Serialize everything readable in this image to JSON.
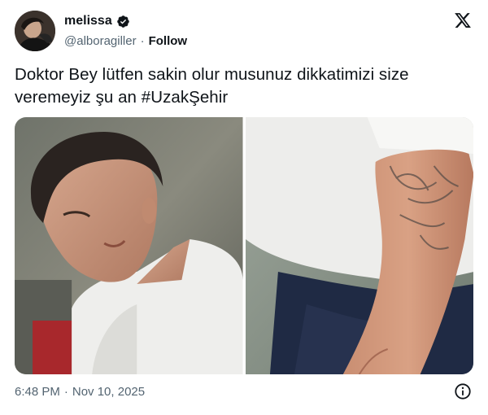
{
  "author": {
    "display_name": "melissa",
    "handle": "@alboragiller",
    "separator": "·",
    "follow_label": "Follow",
    "verified": true,
    "verified_color": "#0f1419"
  },
  "tweet": {
    "text_before_hashtag": "Doktor Bey lütfen sakin olur musunuz dikkatimizi size veremeyiz şu an ",
    "hashtag": "#UzakŞehir"
  },
  "media": {
    "count": 2,
    "images": [
      {
        "description_icon": "photo-man-white-tshirt-bending"
      },
      {
        "description_icon": "photo-tattooed-arm"
      }
    ]
  },
  "meta": {
    "time": "6:48 PM",
    "separator": "·",
    "date": "Nov 10, 2025"
  },
  "icons": {
    "brand": "x-logo-icon",
    "info": "info-icon",
    "verified": "verified-badge-icon"
  },
  "colors": {
    "text_primary": "#0f1419",
    "text_secondary": "#536471",
    "background": "#ffffff"
  }
}
